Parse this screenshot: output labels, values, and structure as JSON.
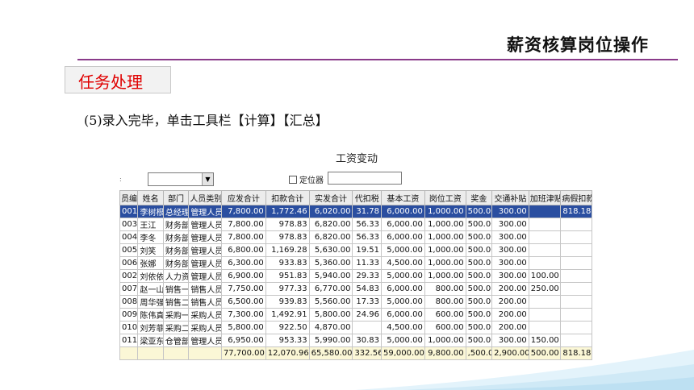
{
  "slide_title": "薪资核算岗位操作",
  "section_label": "任务处理",
  "instruction": "(5)录入完毕，单击工具栏【计算】【汇总】",
  "window": {
    "title": "工资变动",
    "marker": ":",
    "filter_value": "",
    "locate_label": "定位器",
    "locate_value": ""
  },
  "table": {
    "columns": [
      "员编",
      "姓名",
      "部门",
      "人员类别",
      "应发合计",
      "扣款合计",
      "实发合计",
      "代扣税",
      "基本工资",
      "岗位工资",
      "奖金",
      "交通补贴",
      "加班津贴",
      "病假扣款"
    ],
    "rows": [
      [
        "001",
        "李树根",
        "总经理",
        "管理人员",
        "7,800.00",
        "1,772.46",
        "6,020.00",
        "31.78",
        "6,000.00",
        "1,000.00",
        "500.00",
        "300.00",
        "",
        "818.18"
      ],
      [
        "003",
        "王江",
        "财务部",
        "管理人员",
        "7,800.00",
        "978.83",
        "6,820.00",
        "56.33",
        "6,000.00",
        "1,000.00",
        "500.00",
        "300.00",
        "",
        ""
      ],
      [
        "004",
        "李冬",
        "财务部",
        "管理人员",
        "7,800.00",
        "978.83",
        "6,820.00",
        "56.33",
        "6,000.00",
        "1,000.00",
        "500.00",
        "300.00",
        "",
        ""
      ],
      [
        "005",
        "刘笑",
        "财务部",
        "管理人员",
        "6,800.00",
        "1,169.28",
        "5,630.00",
        "19.51",
        "5,000.00",
        "1,000.00",
        "500.00",
        "300.00",
        "",
        ""
      ],
      [
        "006",
        "张娜",
        "财务部",
        "管理人员",
        "6,300.00",
        "933.83",
        "5,360.00",
        "11.33",
        "4,500.00",
        "1,000.00",
        "500.00",
        "300.00",
        "",
        ""
      ],
      [
        "002",
        "刘依依",
        "人力资",
        "管理人员",
        "6,900.00",
        "951.83",
        "5,940.00",
        "29.33",
        "5,000.00",
        "1,000.00",
        "500.00",
        "300.00",
        "100.00",
        ""
      ],
      [
        "007",
        "赵一山",
        "销售一",
        "销售人员",
        "7,750.00",
        "977.33",
        "6,770.00",
        "54.83",
        "6,000.00",
        "800.00",
        "500.00",
        "200.00",
        "250.00",
        ""
      ],
      [
        "008",
        "周华强",
        "销售二",
        "销售人员",
        "6,500.00",
        "939.83",
        "5,560.00",
        "17.33",
        "5,000.00",
        "800.00",
        "500.00",
        "200.00",
        "",
        ""
      ],
      [
        "009",
        "陈伟真",
        "采购一",
        "采购人员",
        "7,300.00",
        "1,492.91",
        "5,800.00",
        "24.96",
        "6,000.00",
        "600.00",
        "500.00",
        "200.00",
        "",
        ""
      ],
      [
        "010",
        "刘芳菲",
        "采购二",
        "采购人员",
        "5,800.00",
        "922.50",
        "4,870.00",
        "",
        "4,500.00",
        "600.00",
        "500.00",
        "200.00",
        "",
        ""
      ],
      [
        "011",
        "梁亚东",
        "仓管部",
        "管理人员",
        "6,950.00",
        "953.33",
        "5,990.00",
        "30.83",
        "5,000.00",
        "1,000.00",
        "500.00",
        "300.00",
        "150.00",
        ""
      ]
    ],
    "totals": [
      "",
      "",
      "",
      "",
      "77,700.00",
      "12,070.96",
      "65,580.00",
      "332.56",
      "59,000.00",
      "9,800.00",
      ",500.00",
      "2,900.00",
      "500.00",
      "818.18"
    ]
  },
  "colors": {
    "accent_rule": "#8a3a8a",
    "section_text": "#e00000",
    "selected_row": "#2a4ea0",
    "total_row": "#fbf7d6"
  },
  "icons": {
    "combo": "chevron-down-icon",
    "checkbox": "checkbox-icon"
  }
}
